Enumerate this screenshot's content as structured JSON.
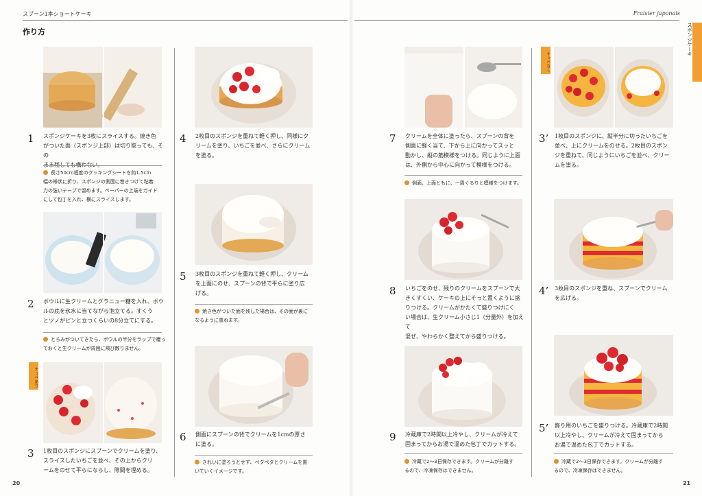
{
  "header": {
    "left_title": "スプーン1本ショートケーキ",
    "right_title": "Fraisier japonais",
    "section": "作り方",
    "tab_label": "スポンジケーキ"
  },
  "colors": {
    "accent": "#f0a030"
  },
  "badges": {
    "with_fruit": "ナッペあり",
    "without_fruit": "ナッペなし"
  },
  "steps": [
    {
      "num": "1",
      "text": [
        "スポンジケーキを3枚にスライスする。焼き色",
        "がついた面（スポンジ上部）は切り取っても、その",
        "まま残しても構わない。"
      ]
    },
    {
      "num": "2",
      "text": [
        "ボウルに生クリームとグラニュー糖を入れ、ボウ",
        "ルの底を氷水に当てながら泡立てる。すくう",
        "とツノがピンと立つくらいの8分立てにする。"
      ]
    },
    {
      "num": "3",
      "text": [
        "1枚目のスポンジにスプーンでクリームを塗り、",
        "スライスしたいちごを並べ、その上からクリ",
        "ームをのせて平らにならし、隙間を埋める。"
      ]
    },
    {
      "num": "4",
      "text": [
        "2枚目のスポンジを重ねて軽く押し、同様にク",
        "リームを塗り、いちごを並べ、さらにクリーム",
        "を塗る。"
      ]
    },
    {
      "num": "5",
      "text": [
        "3枚目のスポンジを重ねて軽く押し、クリーム",
        "を上面にのせ、スプーンの背で平らに塗り広",
        "げる。"
      ]
    },
    {
      "num": "6",
      "text": [
        "側面にスプーンの背でクリームを1cmの厚さ",
        "に塗る。"
      ]
    },
    {
      "num": "7",
      "text": [
        "クリームを全体に塗ったら、スプーンの背を",
        "側面に軽く当て、下から上に向かってスッと",
        "動かし、縦の筋模様をつける。同じように上面",
        "は、外側から中心に向かって模様をつける。"
      ]
    },
    {
      "num": "8",
      "text": [
        "いちごをのせ、残りのクリームをスプーンで大",
        "きくすくい、ケーキの上にそっと置くように盛",
        "りつける。クリームがかたくて盛りつけにく",
        "い場合は、生クリーム小さじ1（分量外）を加えて",
        "混ぜ、やわらかく整えてから盛りつける。"
      ]
    },
    {
      "num": "9",
      "text": [
        "冷蔵庫で2時間以上冷やし、クリームが冷えて",
        "固まってからお湯で温めた包丁でカットする。"
      ]
    },
    {
      "num": "3’",
      "text": [
        "1枚目のスポンジに、縦半分に切ったいちごを",
        "並べ、上にクリームをのせる。2枚目のスポン",
        "ジを重ねて、同じようにいちごを並べ、クリー",
        "ムを塗る。"
      ]
    },
    {
      "num": "4’",
      "text": [
        "3枚目のスポンジを重ね、スプーンでクリーム",
        "を広げる。"
      ]
    },
    {
      "num": "5’",
      "text": [
        "飾り用のいちごを盛りつける。冷蔵庫で2時間",
        "以上冷やし、クリームが冷えて固まってから",
        "お湯で温めた包丁でカットする。"
      ]
    }
  ],
  "tips": [
    {
      "text": [
        "長さ50cm程度のクッキングシートを約1.5cm",
        "幅の帯状に折り、スポンジの側面に巻きつけて粘着",
        "力の強いテープで留めます。ペーパーの上端をガイド",
        "にして包丁を入れ、横にスライスします。"
      ]
    },
    {
      "text": [
        "とろみがついてきたら、ボウルの半分をラップで覆っ",
        "ておくと生クリームが周囲に飛び散りません。"
      ]
    },
    {
      "text": [
        "焼き色がついた面を残した場合は、その面が裏に",
        "なるように重ねます。"
      ]
    },
    {
      "text": [
        "きれいに塗ろうとせず、ペタペタとクリームを置",
        "いていくイメージです。"
      ]
    },
    {
      "text": [
        "側面、上面ともに、一周ぐるりと模様をつけます。"
      ]
    },
    {
      "text": [
        "冷蔵で2〜3日保存できます。クリームが分離す",
        "るので、冷凍保存はできません。"
      ]
    },
    {
      "text": [
        "冷蔵で2〜3日保存できます。クリームが分離す",
        "るので、冷凍保存はできません。"
      ]
    }
  ],
  "folios": {
    "left": "20",
    "right": "21"
  }
}
